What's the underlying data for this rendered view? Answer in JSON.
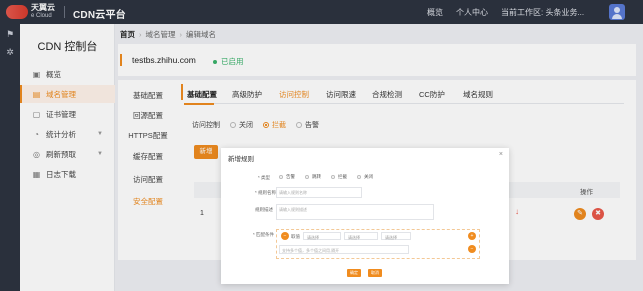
{
  "topbar": {
    "logo_cn": "天翼云",
    "logo_en": "e Cloud",
    "brand": "CDN云平台",
    "nav": [
      "概览",
      "个人中心",
      "当前工作区: 头条业务..."
    ]
  },
  "sidebar": {
    "title": "CDN 控制台",
    "items": [
      {
        "label": "概览",
        "icon": "overview-icon"
      },
      {
        "label": "域名管理",
        "icon": "domain-icon"
      },
      {
        "label": "证书管理",
        "icon": "certificate-icon"
      },
      {
        "label": "统计分析",
        "icon": "stats-icon"
      },
      {
        "label": "刷新预取",
        "icon": "refresh-icon"
      },
      {
        "label": "日志下载",
        "icon": "log-icon"
      }
    ]
  },
  "breadcrumb": [
    "首页",
    "域名管理",
    "编辑域名"
  ],
  "domain": {
    "name": "testbs.zhihu.com",
    "status": "已启用"
  },
  "config_nav": [
    "基础配置",
    "回源配置",
    "HTTPS配置",
    "缓存配置",
    "访问配置",
    "安全配置"
  ],
  "tabs": [
    "基础配置",
    "高级防护",
    "访问控制",
    "访问限速",
    "合规检测",
    "CC防护",
    "域名规则"
  ],
  "access_control": {
    "label": "访问控制",
    "options": [
      "关闭",
      "拦截",
      "告警"
    ]
  },
  "add_button": "新增",
  "table": {
    "row_index": "1",
    "header_fragment": "态",
    "op_header": "操作"
  },
  "modal": {
    "title": "新增规则",
    "close": "×",
    "mode_label": "* 类型",
    "mode_options": [
      "告警",
      "跳转",
      "拦截",
      "关闭"
    ],
    "rule_name_label": "* 规则名称",
    "rule_name_placeholder": "请输入规则名称",
    "desc_label": "规则描述",
    "desc_placeholder": "请输入规则描述",
    "cond_label": "* 匹配条件",
    "cond_tag": "取值",
    "cond_select1": "请选择",
    "cond_select2": "请选择",
    "cond_select3": "请选择",
    "cond_value_placeholder": "支持多个值，多个值之间用,隔开",
    "ok": "确定",
    "cancel": "取消"
  },
  "colors": {
    "accent": "#f08c1f",
    "topbar": "#2d3340",
    "success": "#3ab26b",
    "danger": "#e9594a"
  }
}
